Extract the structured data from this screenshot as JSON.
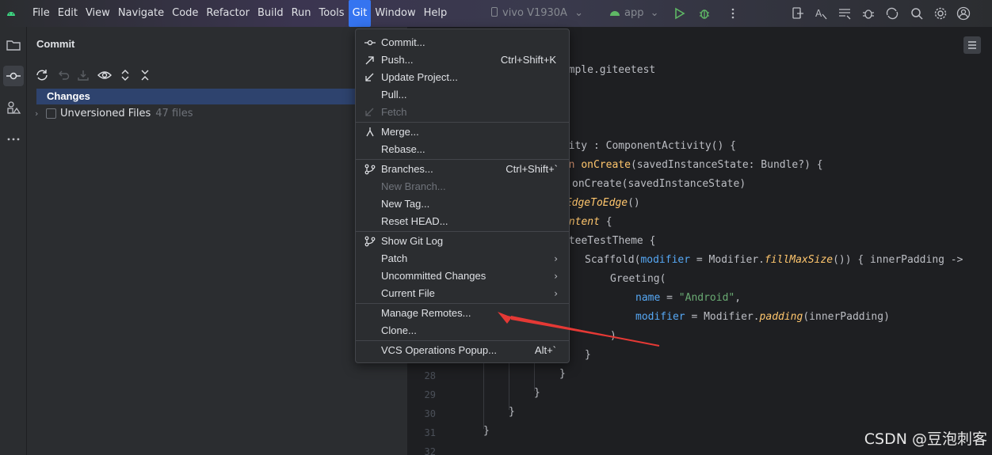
{
  "menubar": {
    "items": [
      "File",
      "Edit",
      "View",
      "Navigate",
      "Code",
      "Refactor",
      "Build",
      "Run",
      "Tools",
      "Git",
      "Window",
      "Help"
    ],
    "active": "Git",
    "device": "vivo V1930A",
    "run_config": "app"
  },
  "commit_panel": {
    "title": "Commit",
    "changes_label": "Changes",
    "unversioned_label": "Unversioned Files",
    "unversioned_count": "47 files"
  },
  "git_menu": {
    "commit": "Commit...",
    "push": "Push...",
    "push_shortcut": "Ctrl+Shift+K",
    "update_project": "Update Project...",
    "pull": "Pull...",
    "fetch": "Fetch",
    "merge": "Merge...",
    "rebase": "Rebase...",
    "branches": "Branches...",
    "branches_shortcut": "Ctrl+Shift+`",
    "new_branch": "New Branch...",
    "new_tag": "New Tag...",
    "reset_head": "Reset HEAD...",
    "show_git_log": "Show Git Log",
    "patch": "Patch",
    "uncommitted_changes": "Uncommitted Changes",
    "current_file": "Current File",
    "manage_remotes": "Manage Remotes...",
    "clone": "Clone...",
    "vcs_popup": "VCS Operations Popup...",
    "vcs_popup_shortcut": "Alt+`"
  },
  "editor": {
    "code": {
      "l1": "xample.giteetest",
      "l2a": "ivity : ComponentActivity() {",
      "l3a": "fun",
      "l3b": "onCreate",
      "l3c": "(savedInstanceState: Bundle?) {",
      "l4": "onCreate(savedInstanceState)",
      "l5": "eEdgeToEdge",
      "l5b": "()",
      "l6": "ontent",
      "l6b": " {",
      "l7": "iteeTestTheme {",
      "l8a": "Scaffold(",
      "l8b": "modifier",
      "l8c": " = Modifier.",
      "l8d": "fillMaxSize",
      "l8e": "()) { innerPadding ->",
      "l9": "Greeting(",
      "l10a": "name",
      "l10b": " = ",
      "l10c": "\"Android\"",
      "l10d": ",",
      "l11a": "modifier",
      "l11b": " = Modifier.",
      "l11c": "padding",
      "l11d": "(innerPadding)",
      "l12": ")",
      "l13": "}",
      "l14": "}",
      "l15": "}",
      "l16": "}",
      "l17": "}"
    },
    "line_numbers": [
      "28",
      "29",
      "30",
      "31",
      "32"
    ]
  },
  "watermark": "CSDN @豆泡刺客",
  "colors": {
    "accent": "#3574f0",
    "arrow": "#e53935"
  }
}
